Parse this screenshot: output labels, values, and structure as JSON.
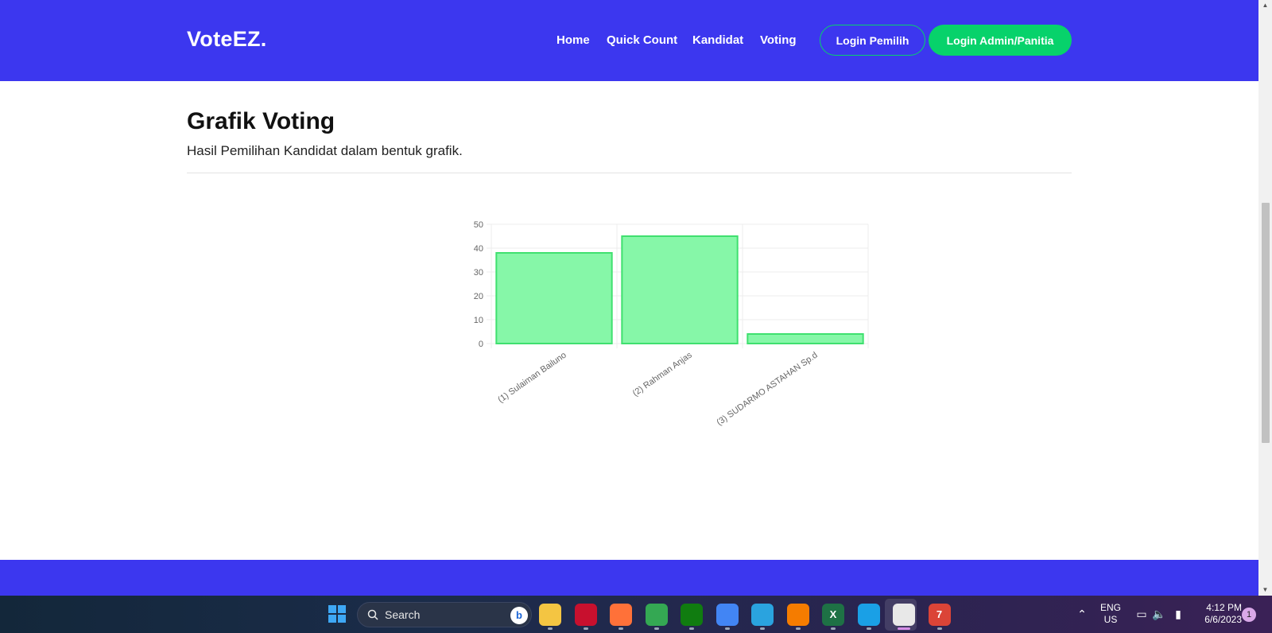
{
  "brand": "VoteEZ.",
  "nav": {
    "links": [
      "Home",
      "Quick Count",
      "Kandidat",
      "Voting"
    ],
    "login_pemilih": "Login Pemilih",
    "login_admin": "Login Admin/Panitia"
  },
  "section": {
    "title": "Grafik Voting",
    "subtitle": "Hasil Pemilihan Kandidat dalam bentuk grafik."
  },
  "chart_data": {
    "type": "bar",
    "categories": [
      "(1) Sulaiman Bailuno",
      "(2) Rahman Anjas",
      "(3) SUDARMO ASTAHAN Sp.d"
    ],
    "values": [
      38,
      45,
      4
    ],
    "ylim": [
      0,
      50
    ],
    "yticks": [
      0,
      10,
      20,
      30,
      40,
      50
    ],
    "bar_fill": "#86f7a8",
    "bar_border": "#3fe06f",
    "grid": true
  },
  "colors": {
    "primary": "#3c37ef",
    "accent": "#07d26b"
  },
  "taskbar": {
    "search_placeholder": "Search",
    "bing_label": "b",
    "apps": [
      {
        "name": "file-explorer-icon",
        "label": "",
        "color": "#f4c542"
      },
      {
        "name": "app-red-icon",
        "label": "",
        "color": "#c8102e"
      },
      {
        "name": "firefox-icon",
        "label": "",
        "color": "#ff7139"
      },
      {
        "name": "chrome-icon",
        "label": "",
        "color": "#34a853"
      },
      {
        "name": "xbox-icon",
        "label": "",
        "color": "#107c10"
      },
      {
        "name": "chrome-icon-2",
        "label": "",
        "color": "#4285f4"
      },
      {
        "name": "telegram-icon",
        "label": "",
        "color": "#2aa3df"
      },
      {
        "name": "search-app-icon",
        "label": "",
        "color": "#f57c00"
      },
      {
        "name": "excel-icon",
        "label": "X",
        "color": "#1e7145"
      },
      {
        "name": "remote-app-icon",
        "label": "",
        "color": "#1aa0e6"
      },
      {
        "name": "snipping-tool-icon",
        "label": "",
        "color": "#e8e8e8"
      },
      {
        "name": "chrome-icon-3",
        "label": "7",
        "color": "#db4437"
      }
    ],
    "lang_line1": "ENG",
    "lang_line2": "US",
    "time": "4:12 PM",
    "date": "6/6/2023",
    "notification_count": "1"
  }
}
